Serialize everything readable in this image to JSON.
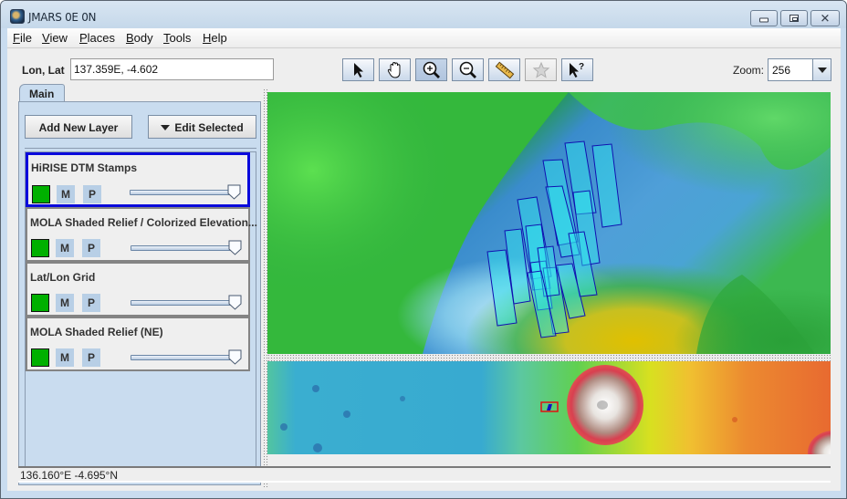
{
  "window": {
    "title": "JMARS 0E 0N",
    "app_icon": "globe-icon",
    "controls": [
      "minimize",
      "maximize",
      "close"
    ]
  },
  "menubar": {
    "items": [
      {
        "label": "File",
        "mnemonic": "F",
        "rest": "ile"
      },
      {
        "label": "View",
        "mnemonic": "V",
        "rest": "iew"
      },
      {
        "label": "Places",
        "mnemonic": "P",
        "rest": "laces"
      },
      {
        "label": "Body",
        "mnemonic": "B",
        "rest": "ody"
      },
      {
        "label": "Tools",
        "mnemonic": "T",
        "rest": "ools"
      },
      {
        "label": "Help",
        "mnemonic": "H",
        "rest": "elp"
      }
    ]
  },
  "location": {
    "label": "Lon, Lat",
    "value": "137.359E, -4.602"
  },
  "toolbar": {
    "tools": [
      {
        "name": "select-tool",
        "icon": "arrow-pointer-icon",
        "active": false,
        "enabled": true
      },
      {
        "name": "pan-tool",
        "icon": "hand-icon",
        "active": false,
        "enabled": true
      },
      {
        "name": "zoom-in-tool",
        "icon": "zoom-in-icon",
        "active": true,
        "enabled": true
      },
      {
        "name": "zoom-out-tool",
        "icon": "zoom-out-icon",
        "active": false,
        "enabled": true
      },
      {
        "name": "measure-tool",
        "icon": "ruler-icon",
        "active": false,
        "enabled": true
      },
      {
        "name": "favorite-tool",
        "icon": "star-icon",
        "active": false,
        "enabled": false
      },
      {
        "name": "investigate-tool",
        "icon": "pointer-question-icon",
        "active": false,
        "enabled": true
      }
    ],
    "zoom_label": "Zoom:",
    "zoom_value": "256"
  },
  "left_panel": {
    "tab_label": "Main",
    "add_layer_label": "Add New Layer",
    "edit_selected_label": "Edit Selected",
    "layers": [
      {
        "name": "HiRISE DTM Stamps",
        "selected": true,
        "color": "#00b000",
        "m_label": "M",
        "p_label": "P",
        "opacity": 1.0
      },
      {
        "name": "MOLA Shaded Relief / Colorized Elevation...",
        "selected": false,
        "color": "#00b000",
        "m_label": "M",
        "p_label": "P",
        "opacity": 1.0
      },
      {
        "name": "Lat/Lon Grid",
        "selected": false,
        "color": "#00b000",
        "m_label": "M",
        "p_label": "P",
        "opacity": 1.0
      },
      {
        "name": "MOLA Shaded Relief (NE)",
        "selected": false,
        "color": "#00b000",
        "m_label": "M",
        "p_label": "P",
        "opacity": 1.0
      }
    ]
  },
  "map": {
    "main_view": "HiRISE DTM stamp footprints over colorized elevation",
    "stamp_outline_color": "#1010b0",
    "stamp_fill_color": "#30e8f0",
    "overview_box_color": "#e01010"
  },
  "status_bar": {
    "coords": "136.160°E   -4.695°N"
  }
}
